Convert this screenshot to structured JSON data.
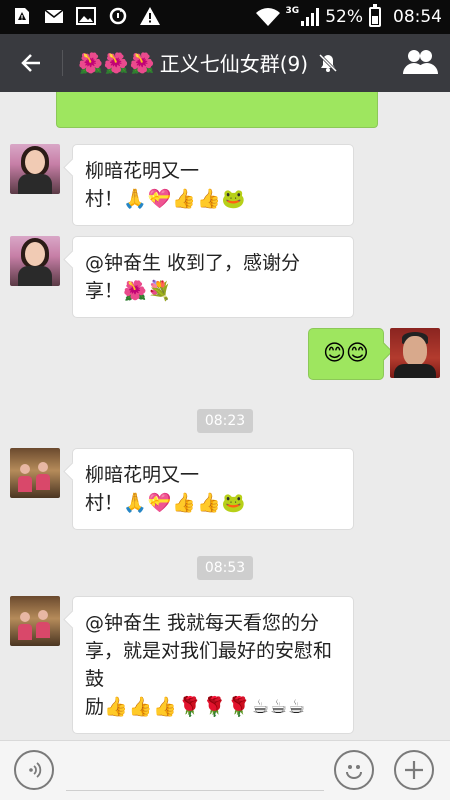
{
  "status_bar": {
    "network_label": "3G",
    "battery_percent": "52%",
    "battery_level": 0.52,
    "time": "08:54",
    "left_icons": [
      "warning-sd-icon",
      "mail-icon",
      "image-icon",
      "sync-icon",
      "warning-icon"
    ]
  },
  "header": {
    "back_label": "←",
    "title_emoji": "🌺🌺🌺",
    "title": "正义七仙女群(9)",
    "mute_icon": "mute-bell-icon",
    "contacts_icon": "group-contacts-icon"
  },
  "messages": [
    {
      "type": "in",
      "line1": "柳暗花明又一",
      "line2_text": "村！",
      "line2_emoji": "🙏💝👍👍🐸"
    },
    {
      "type": "in",
      "line1": "@钟奋生 收到了，感谢分",
      "line2_text": "享！",
      "line2_emoji": "🌺💐"
    },
    {
      "type": "out",
      "emoji": "😊😊"
    },
    {
      "type": "time",
      "text": "08:23"
    },
    {
      "type": "in",
      "line1": "柳暗花明又一",
      "line2_text": "村！",
      "line2_emoji": "🙏💝👍👍🐸"
    },
    {
      "type": "time",
      "text": "08:53"
    },
    {
      "type": "in",
      "line1": "@钟奋生 我就每天看您的分",
      "line2": "享，就是对我们最好的安慰和",
      "line3": "鼓",
      "line4_text": "励",
      "line4_emoji": "👍👍👍🌹🌹🌹☕☕☕"
    }
  ],
  "colors": {
    "status_bg": "#0b0b0b",
    "title_bg": "#393a3f",
    "chat_bg": "#ebebeb",
    "my_bubble": "#9ee65f",
    "their_bubble": "#ffffff"
  }
}
